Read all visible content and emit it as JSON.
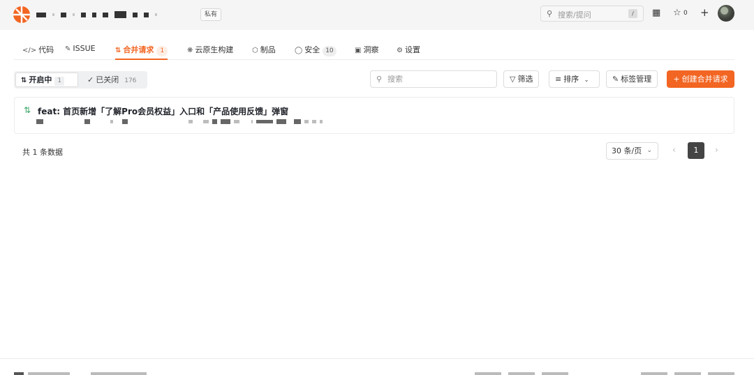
{
  "header": {
    "private_badge": "私有",
    "search_placeholder": "搜索/提问",
    "search_shortcut": "/",
    "star_count": "0",
    "icons": [
      "search-icon",
      "slash-key",
      "building-icon",
      "star-icon",
      "plus-icon",
      "avatar"
    ]
  },
  "tabs": [
    {
      "label": "代码",
      "icon": "code-icon"
    },
    {
      "label": "ISSUE",
      "icon": "issue-icon"
    },
    {
      "label": "合并请求",
      "icon": "merge-request-icon",
      "count": "1",
      "active": true
    },
    {
      "label": "云原生构建",
      "icon": "cloud-build-icon"
    },
    {
      "label": "制品",
      "icon": "package-icon"
    },
    {
      "label": "安全",
      "icon": "shield-icon",
      "count": "10"
    },
    {
      "label": "洞察",
      "icon": "insights-icon"
    },
    {
      "label": "设置",
      "icon": "settings-icon"
    }
  ],
  "filters": {
    "open_label": "开启中",
    "open_count": "1",
    "closed_label": "已关闭",
    "closed_count": "176",
    "search_placeholder": "搜索",
    "filter_label": "筛选",
    "sort_label": "排序",
    "label_manage": "标签管理",
    "create_label": "创建合并请求"
  },
  "merge_requests": [
    {
      "title": "feat: 首页新增「了解Pro会员权益」入口和「产品使用反馈」弹窗",
      "state": "open"
    }
  ],
  "pagination": {
    "total_text": "共 1 条数据",
    "page_size": "30 条/页",
    "current_page": "1"
  },
  "colors": {
    "accent": "#f26522",
    "open_state": "#35a563"
  }
}
